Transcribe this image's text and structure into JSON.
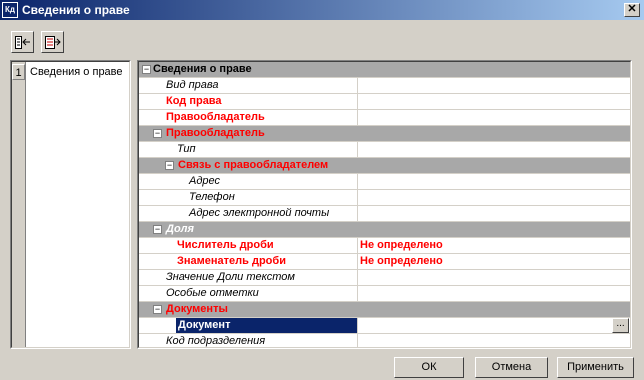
{
  "window": {
    "title": "Сведения о праве",
    "icon_text": "Кд",
    "close_label": "✕"
  },
  "toolbar": {
    "buttons": [
      {
        "icon": "collapse-tree-icon"
      },
      {
        "icon": "expand-tree-icon"
      }
    ]
  },
  "left_panel": {
    "items": [
      {
        "number": "1",
        "label": "Сведения о праве"
      }
    ]
  },
  "grid": {
    "rows": [
      {
        "label": "Сведения о праве",
        "kind": "section",
        "expander": "−",
        "value": ""
      },
      {
        "label": "Вид права",
        "kind": "field",
        "value": ""
      },
      {
        "label": "Код права",
        "kind": "field-required",
        "value": ""
      },
      {
        "label": "Правообладатель",
        "kind": "field-required",
        "value": ""
      },
      {
        "label": "Правообладатель",
        "kind": "subsection-required",
        "expander": "−",
        "value": ""
      },
      {
        "label": "Тип",
        "kind": "field",
        "value": ""
      },
      {
        "label": "Связь с правообладателем",
        "kind": "subsection-required",
        "expander": "−",
        "value": ""
      },
      {
        "label": "Адрес",
        "kind": "field",
        "value": ""
      },
      {
        "label": "Телефон",
        "kind": "field",
        "value": ""
      },
      {
        "label": "Адрес электронной почты",
        "kind": "field",
        "value": ""
      },
      {
        "label": "Доля",
        "kind": "subsection",
        "expander": "−",
        "value": ""
      },
      {
        "label": "Числитель дроби",
        "kind": "field-required",
        "value": "Не определено"
      },
      {
        "label": "Знаменатель дроби",
        "kind": "field-required",
        "value": "Не определено"
      },
      {
        "label": "Значение Доли текстом",
        "kind": "field",
        "value": ""
      },
      {
        "label": "Особые отметки",
        "kind": "field",
        "value": ""
      },
      {
        "label": "Документы",
        "kind": "subsection-required",
        "expander": "−",
        "value": ""
      },
      {
        "label": "Документ",
        "kind": "selected",
        "value": "",
        "button": "..."
      },
      {
        "label": "Код подразделения",
        "kind": "field",
        "value": ""
      }
    ]
  },
  "footer": {
    "ok_label": "ОК",
    "cancel_label": "Отмена",
    "apply_label": "Применить"
  },
  "colors": {
    "title_bar": "#0a246a",
    "required": "#ff0000",
    "section": "#a8a8a8",
    "selected": "#0a246a"
  }
}
